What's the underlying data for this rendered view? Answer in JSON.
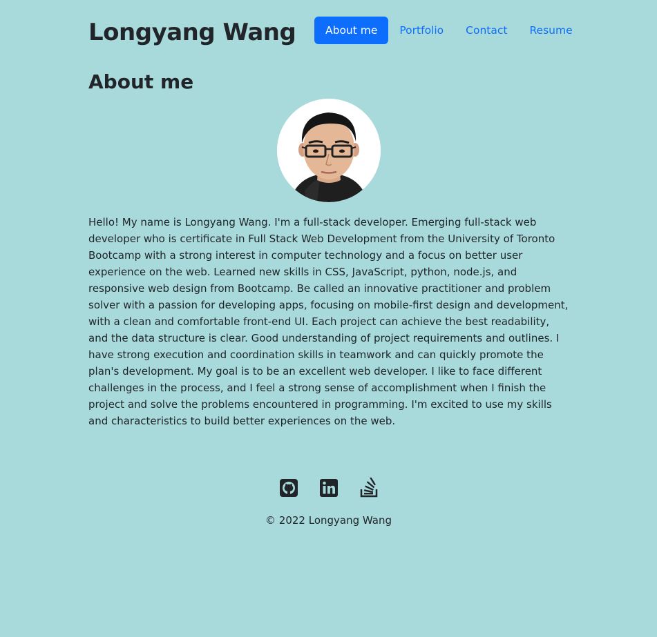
{
  "header": {
    "site_title": "Longyang Wang",
    "nav": [
      {
        "label": "About me",
        "active": true
      },
      {
        "label": "Portfolio",
        "active": false
      },
      {
        "label": "Contact",
        "active": false
      },
      {
        "label": "Resume",
        "active": false
      }
    ]
  },
  "main": {
    "section_title": "About me",
    "avatar_icon": "profile-photo",
    "bio": "Hello! My name is Longyang Wang. I'm a full-stack developer. Emerging full-stack web developer who is certificate in Full Stack Web Development from the University of Toronto Bootcamp with a strong interest in computer technology and a focus on better user experience on the web. Learned new skills in CSS, JavaScript, python, node.js, and responsive web design from Bootcamp. Be called an innovative practitioner and problem solver with a passion for developing apps, focusing on mobile-first design and development, with a clean and comfortable front-end UI. Each project can achieve the best readability, and the data structure is clear. Good understanding of project requirements and outlines. I have strong execution and coordination skills in teamwork and can quickly promote the plan's development. My goal is to be an excellent web developer. I like to face different challenges in the process, and I feel a strong sense of accomplishment when I finish the project and solve the problems encountered in programming. I'm excited to use my skills and characteristics to build better experiences on the web."
  },
  "footer": {
    "social_icons": [
      "github-icon",
      "linkedin-icon",
      "stackoverflow-icon"
    ],
    "copyright": "© 2022 Longyang Wang"
  },
  "colors": {
    "background": "#a8dadc",
    "accent": "#0d6efd",
    "text": "#212529"
  }
}
